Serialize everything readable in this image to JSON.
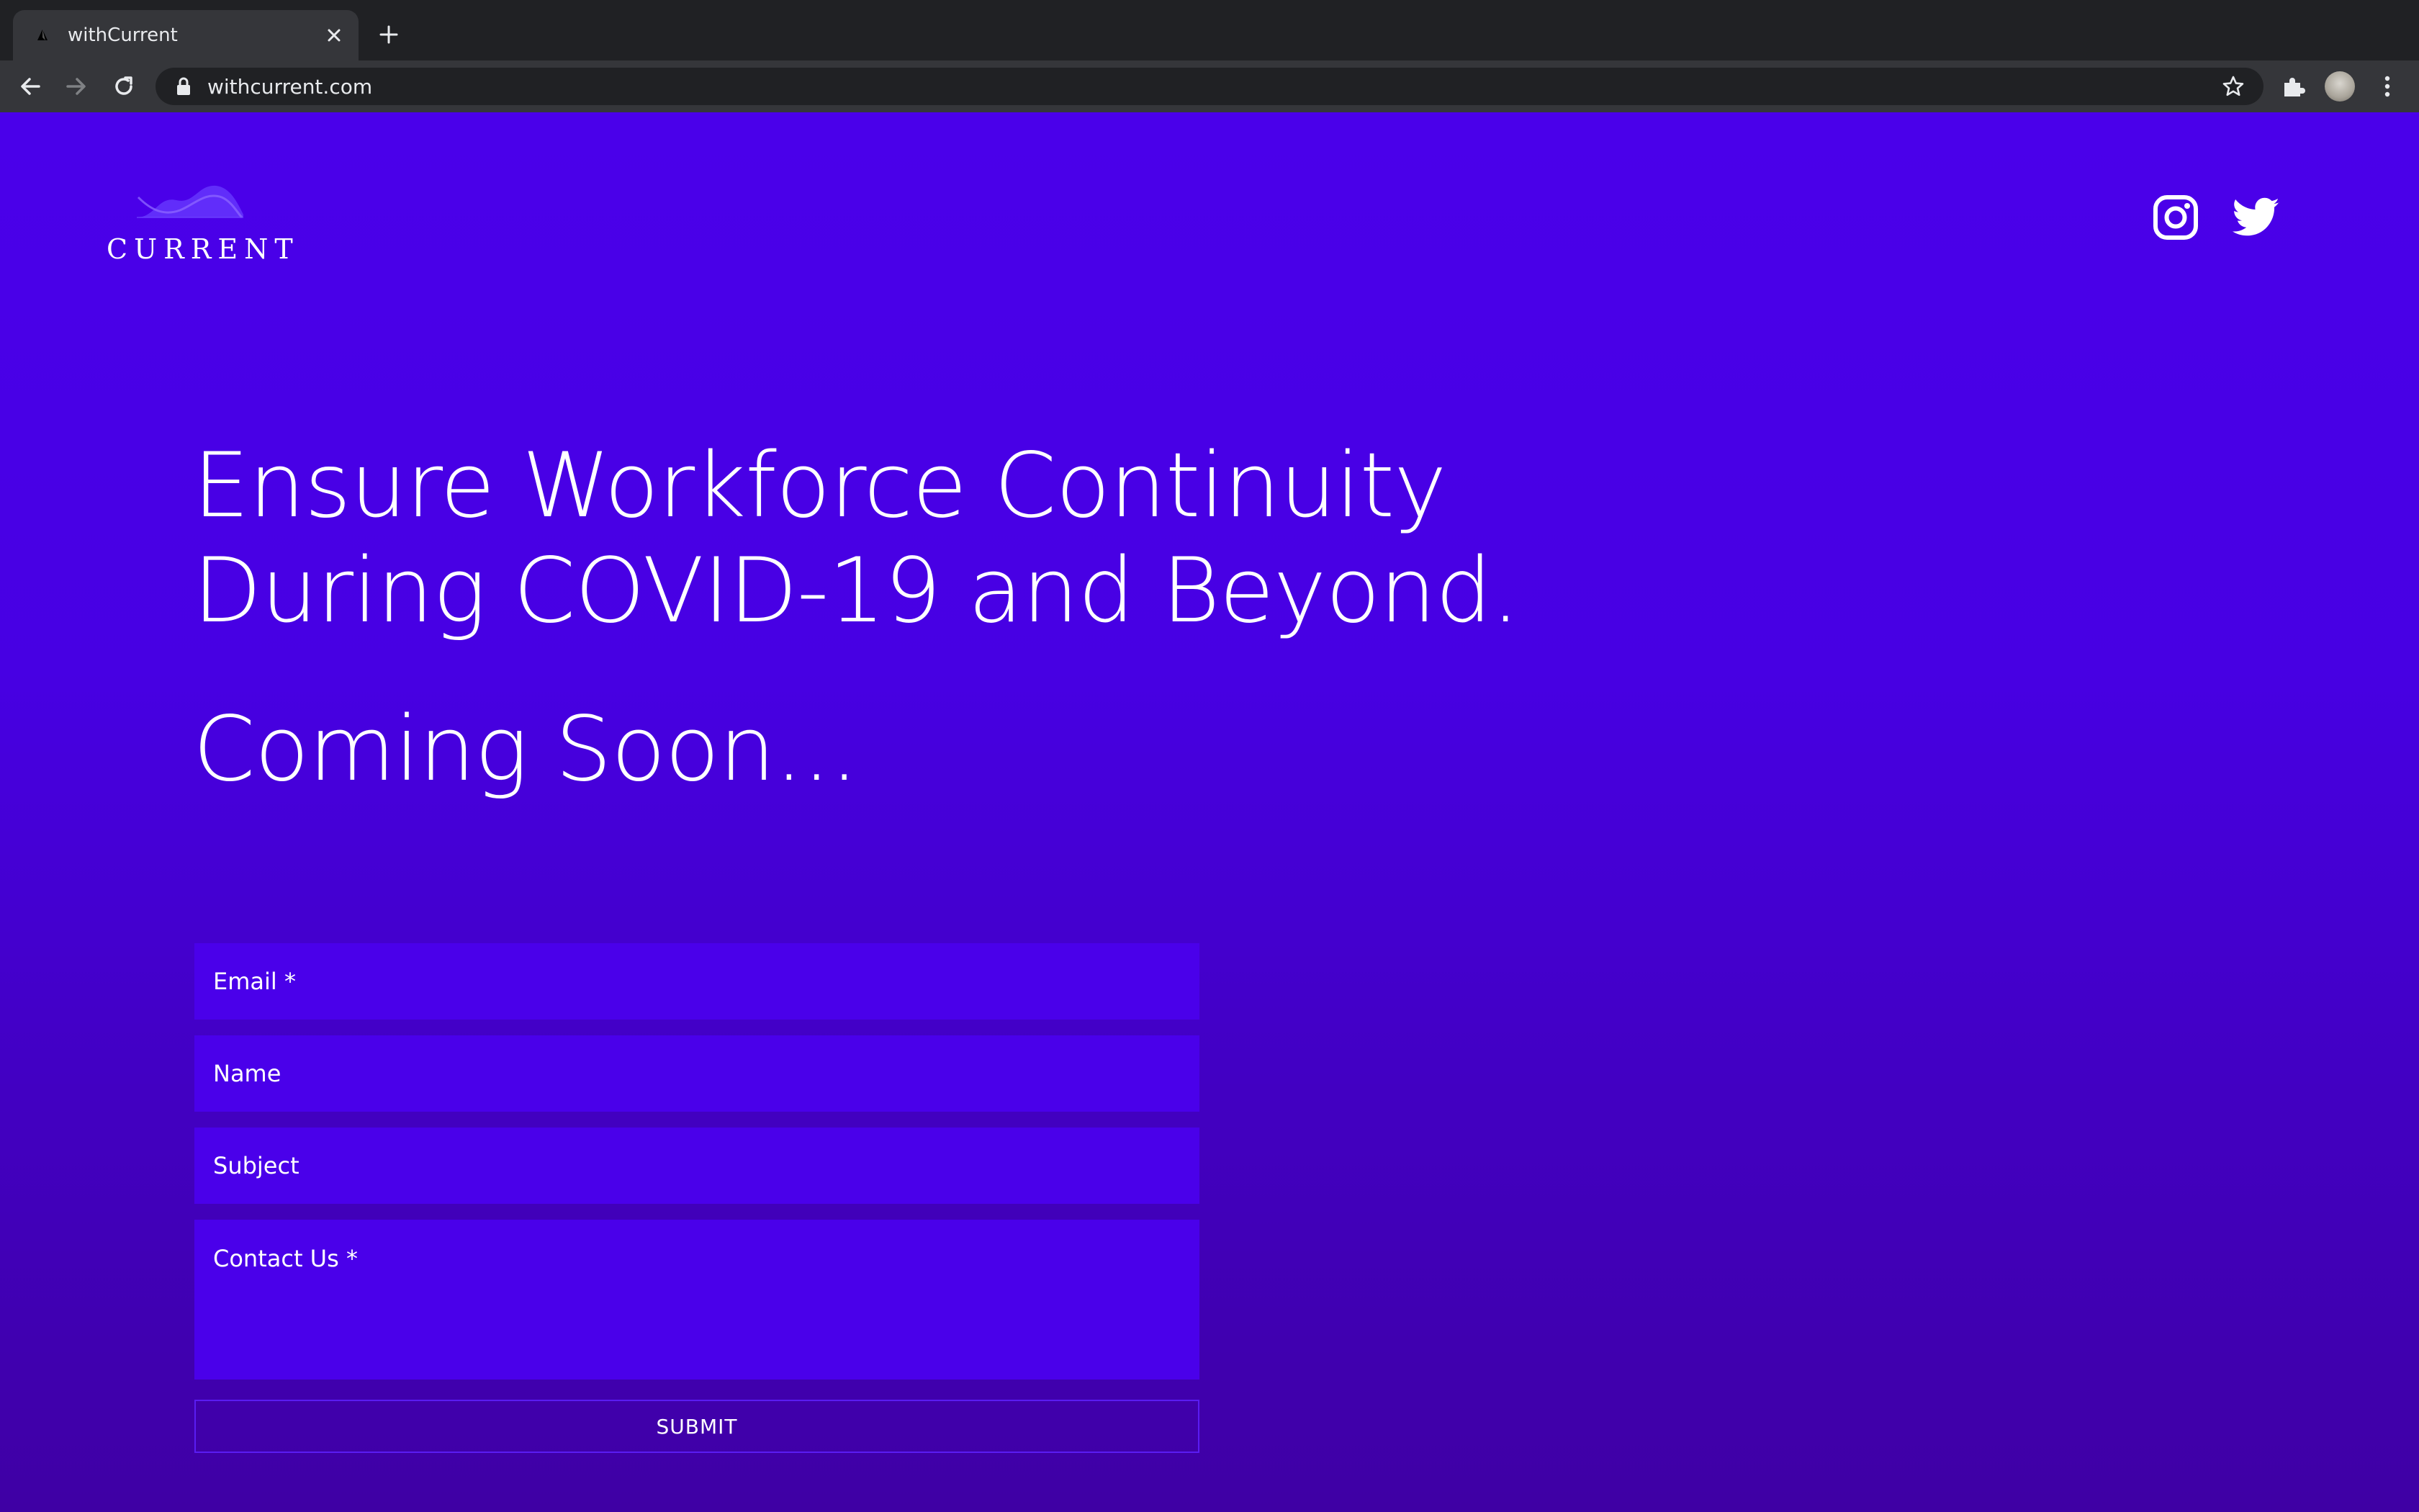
{
  "browser": {
    "tab_title": "withCurrent",
    "url": "withcurrent.com",
    "icons": [
      "back-icon",
      "forward-icon",
      "reload-icon",
      "lock-icon",
      "star-icon",
      "puzzle-icon",
      "avatar",
      "more-vert-icon",
      "close-icon",
      "plus-icon"
    ]
  },
  "header": {
    "logo_text": "CURRENT",
    "social_icons": [
      "instagram-icon",
      "twitter-icon"
    ]
  },
  "hero": {
    "headline": "Ensure Workforce Continuity During COVID-19 and Beyond.",
    "subhead": "Coming Soon..."
  },
  "form": {
    "email_placeholder": "Email *",
    "name_placeholder": "Name",
    "subject_placeholder": "Subject",
    "message_placeholder": "Contact Us *",
    "submit_label": "SUBMIT"
  },
  "colors": {
    "page_top": "#4a00ea",
    "page_bottom": "#3f00a4",
    "field_bg": "#4a00ea",
    "chrome_dark": "#202124",
    "chrome_toolbar": "#35363a"
  }
}
